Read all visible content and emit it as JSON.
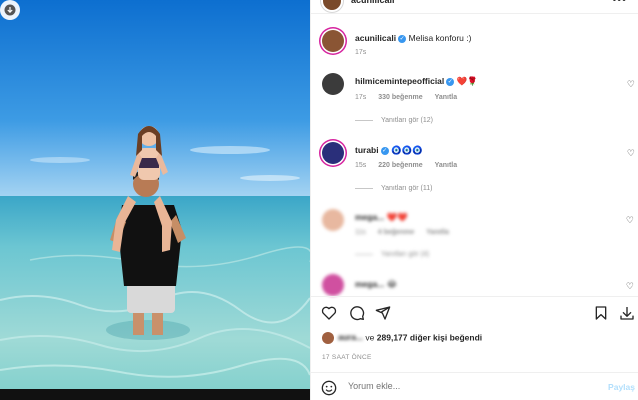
{
  "post": {
    "author": "acunilicali",
    "caption_author": "acunilicali",
    "caption": "Melisa konforu :)",
    "caption_time": "17s",
    "download_icon": "download-icon",
    "more_icon": "more-horizontal-icon"
  },
  "comments": [
    {
      "user": "hilmicemintepeofficial",
      "text": "❤️🌹",
      "time": "17s",
      "likes": "330 beğenme",
      "reply": "Yanıtla",
      "replies": "Yanıtları gör (12)",
      "avatar_color": "#3b3b3b"
    },
    {
      "user": "turabi",
      "text": "🧿🧿🧿",
      "time": "15s",
      "likes": "220 beğenme",
      "reply": "Yanıtla",
      "replies": "Yanıtları gör (11)",
      "avatar_color": "#2a2f7a"
    },
    {
      "user": "mega...",
      "text": "❤️❤️",
      "time": "11s",
      "likes": "4 beğenme",
      "reply": "Yanıtla",
      "replies": "Yanıtları gör (4)",
      "avatar_color": "#e8b8a0"
    },
    {
      "user": "mega...",
      "text": "😂",
      "time": "",
      "likes": "",
      "reply": "",
      "replies": "",
      "avatar_color": "#d050a0"
    }
  ],
  "likes": {
    "prefix_user": "aura...",
    "connector": "ve",
    "count": "289,177",
    "suffix": "diğer kişi beğendi"
  },
  "timestamp": "17 SAAT ÖNCE",
  "comment_input": {
    "placeholder": "Yorum ekle...",
    "post_label": "Paylaş"
  },
  "actions": [
    "like-icon",
    "comment-icon",
    "share-icon",
    "save-icon",
    "download-icon"
  ],
  "colors": {
    "verified": "#3897f0",
    "post_disabled": "#b2dffc",
    "muted": "#8e8e8e"
  }
}
